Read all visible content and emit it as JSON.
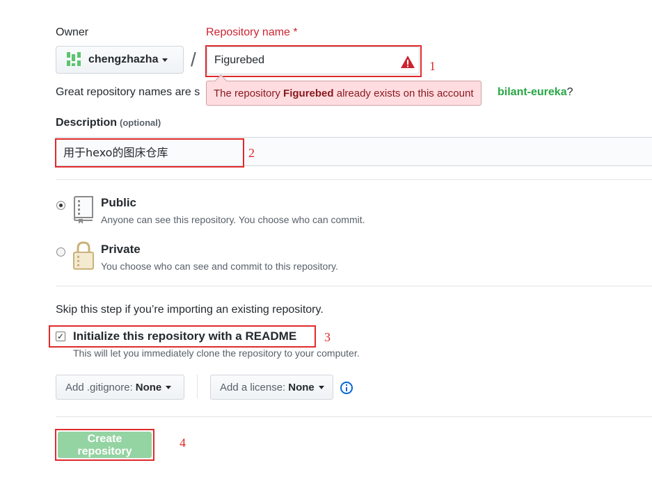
{
  "owner": {
    "label": "Owner",
    "name": "chengzhazha"
  },
  "repo": {
    "label": "Repository name *",
    "value": "Figurebed",
    "separator": "/",
    "error_prefix": "The repository ",
    "error_name": "Figurebed",
    "error_suffix": " already exists on this account"
  },
  "hint": {
    "text": "Great repository names are s",
    "suggestion": "bilant-eureka",
    "tail": "?"
  },
  "description": {
    "label": "Description",
    "optional": "(optional)",
    "value": "用于hexo的图床仓库"
  },
  "visibility": {
    "public": {
      "title": "Public",
      "note": "Anyone can see this repository. You choose who can commit.",
      "selected": true
    },
    "private": {
      "title": "Private",
      "note": "You choose who can see and commit to this repository.",
      "selected": false
    }
  },
  "init": {
    "skip_text": "Skip this step if you’re importing an existing repository.",
    "readme_label": "Initialize this repository with a README",
    "readme_note": "This will let you immediately clone the repository to your computer.",
    "checked": true
  },
  "gitignore": {
    "label": "Add .gitignore:",
    "value": "None"
  },
  "license": {
    "label": "Add a license:",
    "value": "None"
  },
  "create_button": "Create repository",
  "annotations": [
    "1",
    "2",
    "3",
    "4"
  ],
  "colors": {
    "error": "#cb2431",
    "highlight": "#e02a2a",
    "create_button": "#94d3a2",
    "suggestion": "#28a745"
  },
  "icons": {
    "owner_avatar": "identicon-avatar",
    "warning": "alert-triangle-icon",
    "public": "repo-book-icon",
    "private": "lock-icon",
    "info": "info-circle-icon"
  }
}
